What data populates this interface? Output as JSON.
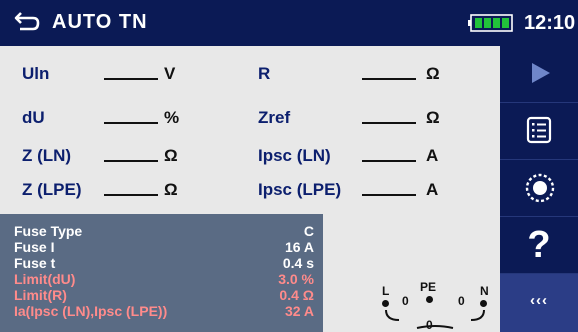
{
  "header": {
    "title": "AUTO TN",
    "time": "12:10"
  },
  "params": {
    "left": [
      {
        "label": "Uln",
        "unit": "V"
      },
      {
        "label": "dU",
        "unit": "%"
      },
      {
        "label": "Z (LN)",
        "unit": "Ω"
      },
      {
        "label": "Z (LPE)",
        "unit": "Ω"
      }
    ],
    "right": [
      {
        "label": "R",
        "unit": "Ω"
      },
      {
        "label": "Zref",
        "unit": "Ω"
      },
      {
        "label": "Ipsc (LN)",
        "unit": "A"
      },
      {
        "label": "Ipsc (LPE)",
        "unit": "A"
      }
    ]
  },
  "info": {
    "rows": [
      {
        "key": "Fuse Type",
        "value": "C"
      },
      {
        "key": "Fuse I",
        "value": "16 A"
      },
      {
        "key": "Fuse t",
        "value": "0.4 s"
      },
      {
        "key": "Limit(dU)",
        "value": "3.0 %"
      },
      {
        "key": "Limit(R)",
        "value": "0.4 Ω"
      },
      {
        "key": "Ia(Ipsc (LN),Ipsc (LPE))",
        "value": "32 A"
      }
    ]
  },
  "terminals": {
    "labels": {
      "l": "L",
      "pe": "PE",
      "n": "N"
    },
    "values": [
      "0",
      "0",
      "0"
    ]
  },
  "sidebar": {
    "help_label": "?",
    "more_label": "‹‹‹"
  },
  "colors": {
    "header_bg": "#0b1a55",
    "label_blue": "#0c1f6e",
    "limit_red": "#ff8b8b",
    "battery_green": "#22c33a"
  }
}
